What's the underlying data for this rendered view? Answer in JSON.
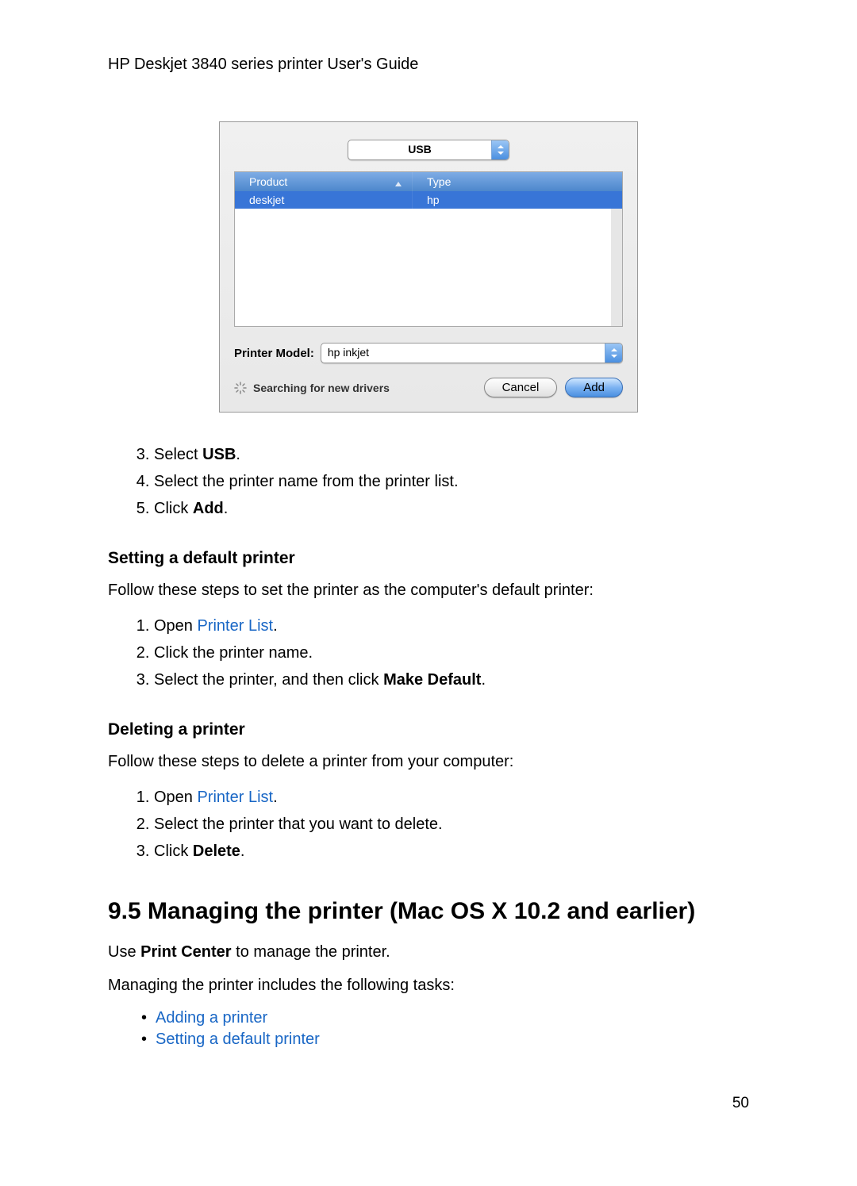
{
  "header": {
    "title": "HP Deskjet 3840 series printer User's Guide"
  },
  "dialog": {
    "connection_type": "USB",
    "table": {
      "columns": {
        "product": "Product",
        "type": "Type"
      },
      "rows": [
        {
          "product": "deskjet",
          "type": "hp"
        }
      ]
    },
    "printer_model_label": "Printer Model:",
    "printer_model_value": "hp inkjet",
    "status": "Searching for new drivers",
    "buttons": {
      "cancel": "Cancel",
      "add": "Add"
    }
  },
  "steps_top": {
    "start": 3,
    "items": [
      {
        "prefix": "Select ",
        "bold": "USB",
        "suffix": "."
      },
      {
        "text": "Select the printer name from the printer list."
      },
      {
        "prefix": "Click ",
        "bold": "Add",
        "suffix": "."
      }
    ]
  },
  "section_default": {
    "title": "Setting a default printer",
    "intro": "Follow these steps to set the printer as the computer's default printer:",
    "steps": [
      {
        "prefix": "Open ",
        "link": "Printer List",
        "suffix": "."
      },
      {
        "text": "Click the printer name."
      },
      {
        "prefix": "Select the printer, and then click ",
        "bold": "Make Default",
        "suffix": "."
      }
    ]
  },
  "section_delete": {
    "title": "Deleting a printer",
    "intro": "Follow these steps to delete a printer from your computer:",
    "steps": [
      {
        "prefix": "Open ",
        "link": "Printer List",
        "suffix": "."
      },
      {
        "text": "Select the printer that you want to delete."
      },
      {
        "prefix": "Click ",
        "bold": "Delete",
        "suffix": "."
      }
    ]
  },
  "section_95": {
    "title": "9.5  Managing the printer (Mac OS X 10.2 and earlier)",
    "p1_prefix": "Use ",
    "p1_bold": "Print Center",
    "p1_suffix": " to manage the printer.",
    "p2": "Managing the printer includes the following tasks:",
    "bullets": [
      "Adding a printer",
      "Setting a default printer"
    ]
  },
  "page_number": "50"
}
